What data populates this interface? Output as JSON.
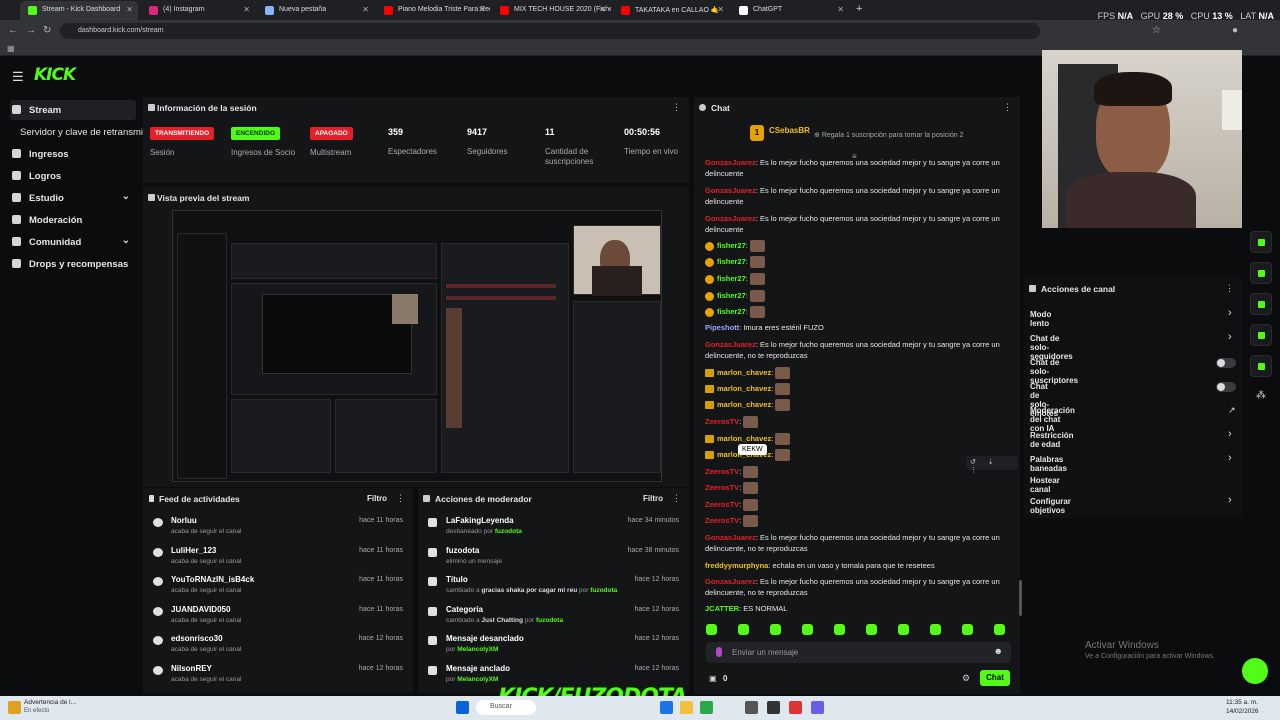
{
  "browser": {
    "tabs": [
      {
        "title": "Stream - Kick Dashboard",
        "active": true,
        "color": "#53fc18"
      },
      {
        "title": "(4) Instagram",
        "color": "#d6297c"
      },
      {
        "title": "Nueva pestaña",
        "color": "#8ab4f8"
      },
      {
        "title": "Piano Melodia Triste Para Reco",
        "color": "#ff0000"
      },
      {
        "title": "MIX TECH HOUSE 2020 (Fisher",
        "color": "#ff0000"
      },
      {
        "title": "TAKATAKA en CALLAO 🤙",
        "color": "#ff0000"
      },
      {
        "title": "ChatGPT",
        "color": "#ffffff"
      }
    ],
    "url": "dashboard.kick.com/stream",
    "sysmon": {
      "fps_label": "FPS",
      "fps": "N/A",
      "gpu_label": "GPU",
      "gpu": "28 %",
      "cpu_label": "CPU",
      "cpu": "13 %",
      "lat_label": "LAT",
      "lat": "N/A"
    }
  },
  "header": {
    "logo": "KICK"
  },
  "sidebar": {
    "items": [
      {
        "label": "Stream",
        "active": true
      },
      {
        "label": "Servidor y clave de retransmisión"
      },
      {
        "label": "Ingresos"
      },
      {
        "label": "Logros"
      },
      {
        "label": "Estudio",
        "chevron": true
      },
      {
        "label": "Moderación"
      },
      {
        "label": "Comunidad",
        "chevron": true
      },
      {
        "label": "Drops y recompensas"
      }
    ]
  },
  "session": {
    "title": "Información de la sesión",
    "stats": [
      {
        "badge": "TRANSMITIENDO",
        "badge_color": "#e5202a",
        "label": "Sesión"
      },
      {
        "badge": "ENCENDIDO",
        "badge_color": "#53fc18",
        "label": "Ingresos de Socio"
      },
      {
        "badge": "APAGADO",
        "badge_color": "#e5202a",
        "label": "Multistream"
      },
      {
        "value": "359",
        "label": "Espectadores"
      },
      {
        "value": "9417",
        "label": "Seguidores"
      },
      {
        "value": "11",
        "label": "Cantidad de suscripciones"
      },
      {
        "value": "00:50:56",
        "label": "Tiempo en vivo"
      }
    ]
  },
  "preview": {
    "title": "Vista previa del stream"
  },
  "feed": {
    "title": "Feed de actividades",
    "filter": "Filtro",
    "items": [
      {
        "name": "Norluu",
        "sub": "acaba de seguir el canal",
        "time": "hace 11 horas"
      },
      {
        "name": "LuliHer_123",
        "sub": "acaba de seguir el canal",
        "time": "hace 11 horas"
      },
      {
        "name": "YouToRNAzIN_isB4ck",
        "sub": "acaba de seguir el canal",
        "time": "hace 11 horas"
      },
      {
        "name": "JUANDAVID050",
        "sub": "acaba de seguir el canal",
        "time": "hace 11 horas"
      },
      {
        "name": "edsonrisco30",
        "sub": "acaba de seguir el canal",
        "time": "hace 12 horas"
      },
      {
        "name": "NilsonREY",
        "sub": "acaba de seguir el canal",
        "time": "hace 12 horas"
      }
    ]
  },
  "mod": {
    "title": "Acciones de moderador",
    "filter": "Filtro",
    "items": [
      {
        "name": "LaFakingLeyenda",
        "sub_pre": "desbaneado",
        "sub_mid": "",
        "sub_by": "por",
        "actor": "fuzodota",
        "time": "hace 34 minutos"
      },
      {
        "name": "fuzodota",
        "sub_pre": "eliminó un mensaje",
        "sub_mid": "",
        "sub_by": "",
        "actor": "",
        "time": "hace 38 minutos"
      },
      {
        "name": "Título",
        "sub_pre": "cambiado a",
        "sub_mid": "gracias shaka por cagar mi reu",
        "sub_by": "por",
        "actor": "fuzodota",
        "time": "hace 12 horas"
      },
      {
        "name": "Categoría",
        "sub_pre": "cambiado a",
        "sub_mid": "Just Chatting",
        "sub_by": "por",
        "actor": "fuzodota",
        "time": "hace 12 horas"
      },
      {
        "name": "Mensaje desanclado",
        "sub_pre": "",
        "sub_mid": "",
        "sub_by": "por",
        "actor": "MelancolyXM",
        "time": "hace 12 horas"
      },
      {
        "name": "Mensaje anclado",
        "sub_pre": "",
        "sub_mid": "",
        "sub_by": "por",
        "actor": "MelancolyXM",
        "time": "hace 12 horas"
      }
    ]
  },
  "chat": {
    "title": "Chat",
    "top_user": "CSebasBR",
    "top_gift": "Regala 1 suscripción para tomar la posición 2",
    "msgs": [
      {
        "user": "GonzasJuarez",
        "text": "Es lo mejor fucho queremos una sociedad mejor y tu sangre ya corre un delincuente",
        "color": "#e5202a"
      },
      {
        "user": "GonzasJuarez",
        "text": "Es lo mejor fucho queremos una sociedad mejor y tu sangre ya corre un delincuente",
        "color": "#e5202a"
      },
      {
        "user": "GonzasJuarez",
        "text": "Es lo mejor fucho queremos una sociedad mejor y tu sangre ya corre un delincuente",
        "color": "#e5202a"
      },
      {
        "user": "fisher27",
        "text": "",
        "color": "#53fc18",
        "badge": true,
        "emote": true
      },
      {
        "user": "fisher27",
        "text": "",
        "color": "#53fc18",
        "badge": true,
        "emote": true
      },
      {
        "user": "fisher27",
        "text": "",
        "color": "#53fc18",
        "badge": true,
        "emote": true
      },
      {
        "user": "fisher27",
        "text": "",
        "color": "#53fc18",
        "badge": true,
        "emote": true
      },
      {
        "user": "fisher27",
        "text": "",
        "color": "#53fc18",
        "badge": true,
        "emote": true
      },
      {
        "user": "Pipeshott",
        "text": "Imura eres estéril FUZO",
        "color": "#9aa6ff"
      },
      {
        "user": "GonzasJuarez",
        "text": "Es lo mejor fucho queremos una sociedad mejor y tu sangre ya corre un delincuente, no te reproduzcas",
        "color": "#e5202a"
      },
      {
        "user": "marlon_chavez",
        "text": "",
        "color": "#f0c020",
        "crown": true,
        "emote": true
      },
      {
        "user": "marlon_chavez",
        "text": "",
        "color": "#f0c020",
        "crown": true,
        "emote": true
      },
      {
        "user": "marlon_chavez",
        "text": "",
        "color": "#f0c020",
        "crown": true,
        "emote": true
      },
      {
        "user": "ZeerosTV",
        "text": "",
        "color": "#e5202a",
        "emote": true
      },
      {
        "user": "marlon_chavez",
        "text": "",
        "color": "#f0c020",
        "crown": true,
        "emote": true
      },
      {
        "user": "marlon_chavez",
        "text": "",
        "color": "#f0c020",
        "crown": true,
        "emote": true
      },
      {
        "user": "ZeerosTV",
        "text": "",
        "color": "#e5202a",
        "emote": true
      },
      {
        "user": "ZeerosTV",
        "text": "",
        "color": "#e5202a",
        "emote": true
      },
      {
        "user": "ZeerosTV",
        "text": "",
        "color": "#e5202a",
        "emote": true
      },
      {
        "user": "ZeerosTV",
        "text": "",
        "color": "#e5202a",
        "emote": true
      },
      {
        "user": "GonzasJuarez",
        "text": "Es lo mejor fucho queremos una sociedad mejor y tu sangre ya corre un delincuente, no te reproduzcas",
        "color": "#e5202a"
      },
      {
        "user": "freddyymurphyna",
        "text": "echala en un vaso y tomala para que te resetees",
        "color": "#f0c020"
      },
      {
        "user": "GonzasJuarez",
        "text": "Es lo mejor fucho queremos una sociedad mejor y tu sangre ya corre un delincuente, no te reproduzcas",
        "color": "#e5202a"
      },
      {
        "user": "JCATTER",
        "text": "ES NORMAL",
        "color": "#53fc18"
      }
    ],
    "tooltip": "KEKW",
    "input_placeholder": "Enviar un mensaje",
    "points": "0",
    "send": "Chat"
  },
  "actions": {
    "title": "Acciones de canal",
    "items": [
      {
        "label": "Modo lento",
        "type": "chevron"
      },
      {
        "label": "Chat de solo-seguidores",
        "type": "chevron"
      },
      {
        "label": "Chat de solo-suscriptores",
        "type": "toggle"
      },
      {
        "label": "Chat de solo-emotes",
        "type": "toggle"
      },
      {
        "label": "Moderación del chat con IA",
        "type": "link"
      },
      {
        "label": "Restricción de edad",
        "type": "chevron"
      },
      {
        "label": "Palabras baneadas",
        "type": "chevron"
      },
      {
        "label": "Hostear canal",
        "type": "none"
      },
      {
        "label": "Configurar objetivos",
        "type": "chevron"
      }
    ]
  },
  "watermark": {
    "line1": "Activar Windows",
    "line2": "Ve a Configuración para activar Windows."
  },
  "overlay": {
    "text": "KICK/FUZODOTA"
  },
  "taskbar": {
    "notice": "Advertencia de l...",
    "notice_sub": "En efecto",
    "search": "Buscar",
    "time": "11:35 a. m.",
    "date": "14/02/2026"
  }
}
